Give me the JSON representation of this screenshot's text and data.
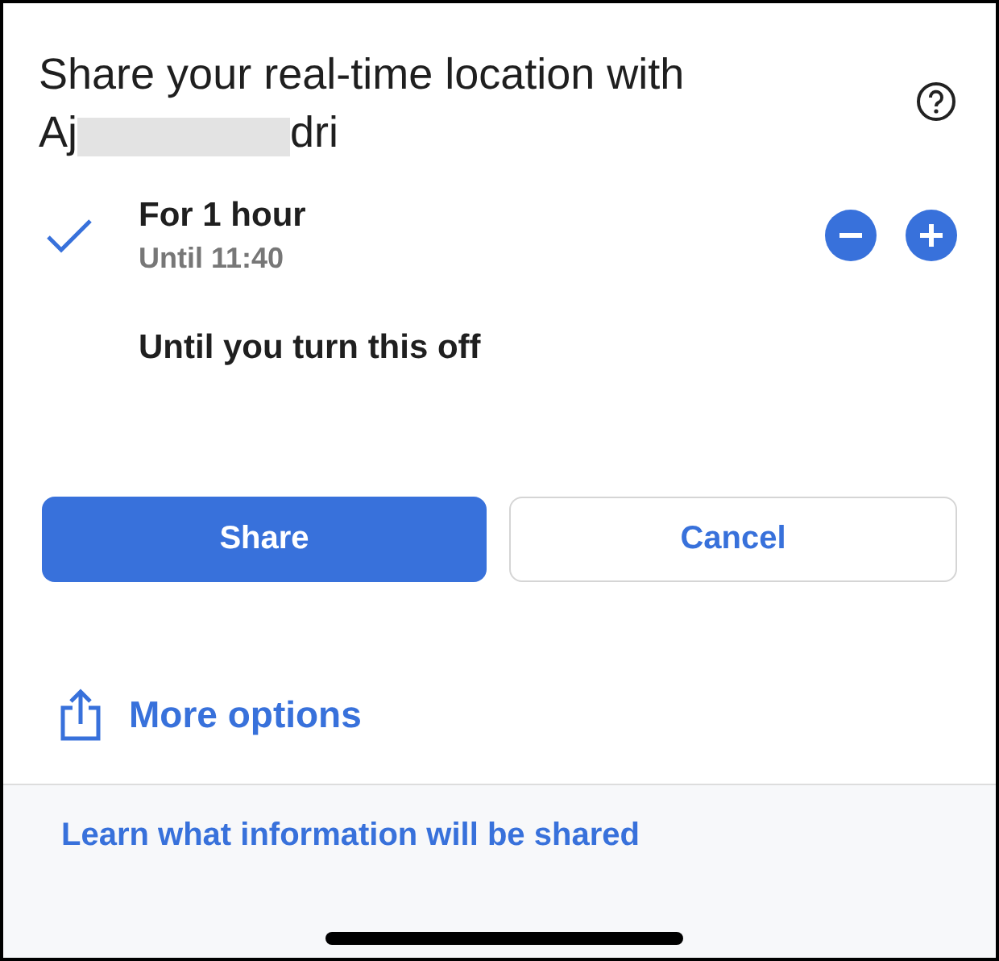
{
  "title": "Share your real-time location with",
  "recipient": {
    "start": "Aj",
    "end": "dri"
  },
  "options": [
    {
      "label": "For 1 hour",
      "subtitle": "Until 11:40",
      "selected": true,
      "kind": "stepper"
    },
    {
      "label": "Until you turn this off",
      "selected": false,
      "kind": "plain"
    }
  ],
  "buttons": [
    {
      "label": "Share",
      "kind": "primary"
    },
    {
      "label": "Cancel",
      "kind": "secondary"
    }
  ],
  "more_options": "More options",
  "footer_link": "Learn what information will be shared"
}
